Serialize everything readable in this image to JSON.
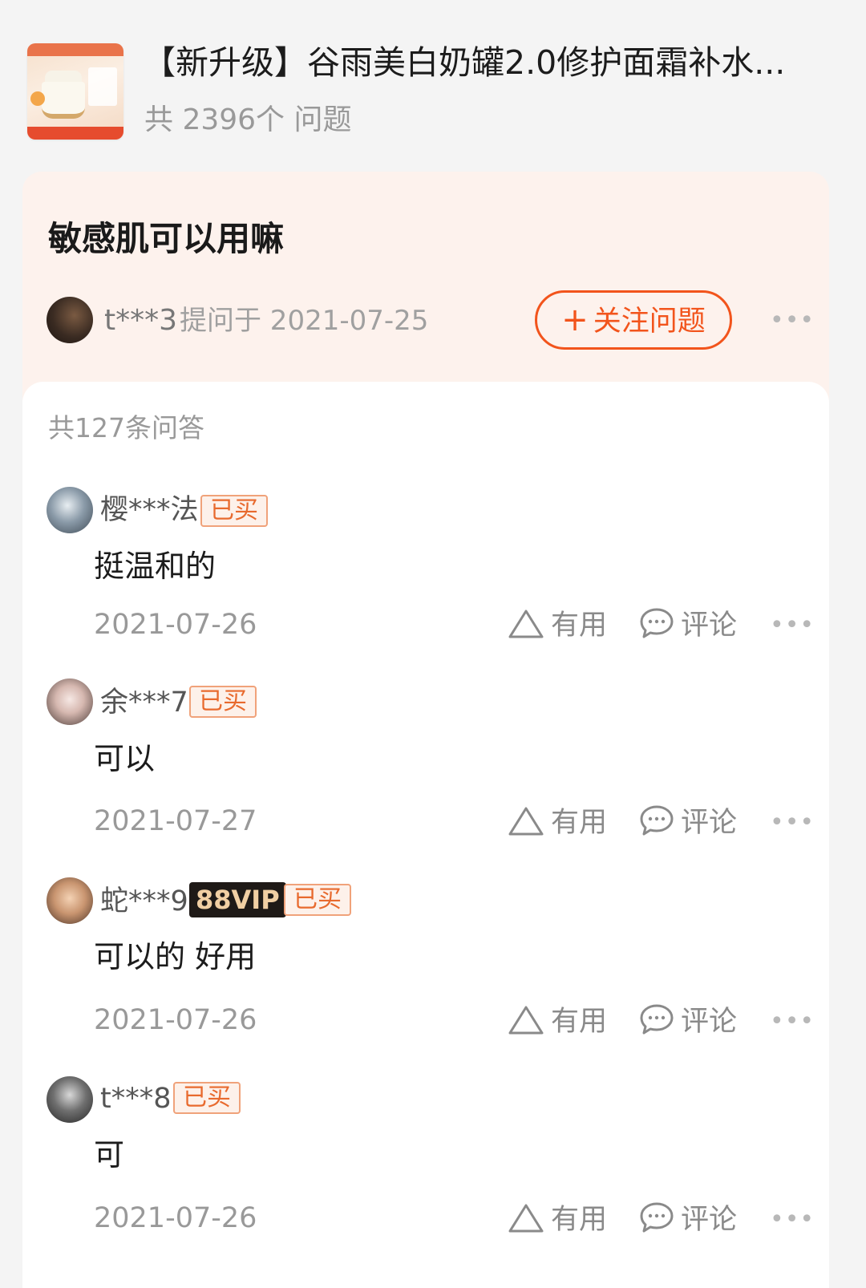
{
  "product": {
    "title": "【新升级】谷雨美白奶罐2.0修护面霜补水...",
    "question_count": "共 2396个 问题",
    "thumbnail_icon": "product-jar-image"
  },
  "question": {
    "text": "敏感肌可以用嘛",
    "user": "t***3",
    "asked": "提问于 2021-07-25",
    "follow_label": "关注问题",
    "follow_icon": "plus-icon",
    "more": "•••"
  },
  "answers_total": "共127条问答",
  "labels": {
    "useful": "有用",
    "comment": "评论",
    "more": "•••"
  },
  "answers": [
    {
      "user": "樱***法",
      "tags": [
        "已买"
      ],
      "text": "挺温和的",
      "date": "2021-07-26"
    },
    {
      "user": "余***7",
      "tags": [
        "已买"
      ],
      "text": "可以",
      "date": "2021-07-27"
    },
    {
      "user": "蛇***9",
      "vip": "88VIP",
      "tags": [
        "已买"
      ],
      "text": "可以的 好用",
      "date": "2021-07-26"
    },
    {
      "user": "t***8",
      "tags": [
        "已买"
      ],
      "text": "可",
      "date": "2021-07-26"
    }
  ],
  "colors": {
    "accent": "#f2541c",
    "question_bg": "#fdf2ed",
    "page_bg": "#f4f4f4",
    "tag_text": "#e86a2e"
  }
}
